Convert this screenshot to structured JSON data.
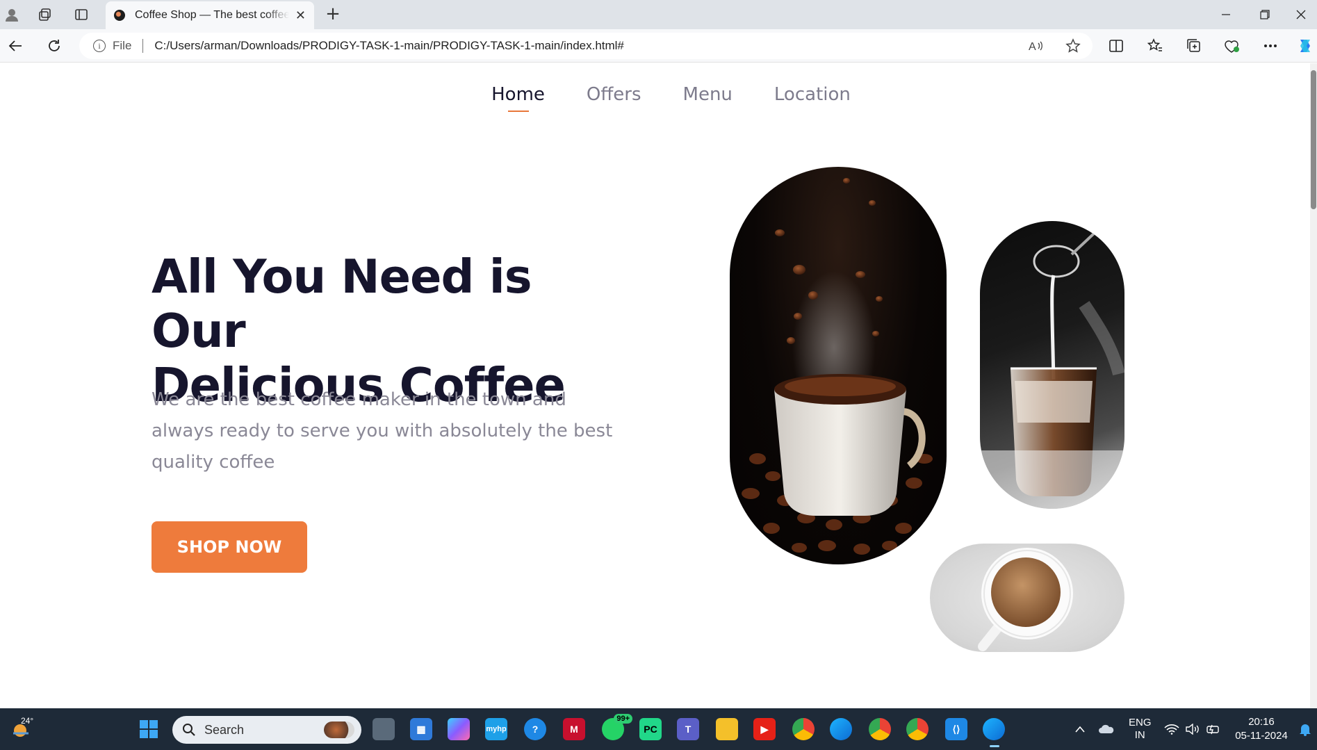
{
  "browser": {
    "tab_title": "Coffee Shop — The best coffee at",
    "file_label": "File",
    "url": "C:/Users/arman/Downloads/PRODIGY-TASK-1-main/PRODIGY-TASK-1-main/index.html#"
  },
  "nav": {
    "items": [
      {
        "label": "Home"
      },
      {
        "label": "Offers"
      },
      {
        "label": "Menu"
      },
      {
        "label": "Location"
      }
    ]
  },
  "hero": {
    "title_line1": "All You Need is Our",
    "title_line2": "Delicious Coffee",
    "description": "We are the best coffee maker in the town and always ready to serve you with absolutely the best quality coffee",
    "cta_label": "SHOP NOW"
  },
  "colors": {
    "accent": "#ee7b3c",
    "heading": "#16152d",
    "muted": "#8a8896"
  },
  "taskbar": {
    "weather_temp": "24°",
    "search_label": "Search",
    "whatsapp_badge": "99+",
    "lang_line1": "ENG",
    "lang_line2": "IN",
    "time": "20:16",
    "date": "05-11-2024"
  }
}
